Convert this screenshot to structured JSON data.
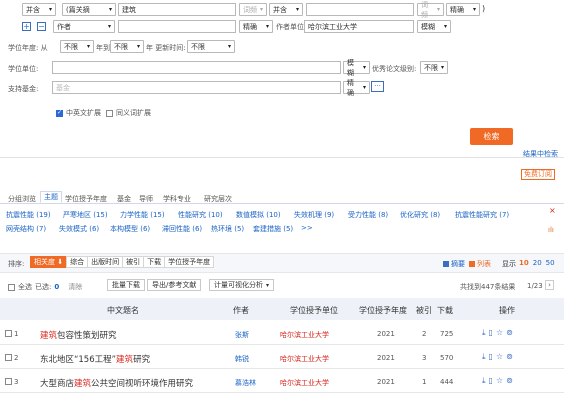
{
  "search": {
    "row1": {
      "logic": "并含",
      "field": "(篇关摘",
      "value": "建筑",
      "fuzzy": "词频",
      "logic2": "并含",
      "precision": "精确"
    },
    "row2": {
      "plus": "⊞",
      "minus": "⊟",
      "field": "作者",
      "value": "",
      "precision": "精确",
      "unit_label": "作者单位:",
      "unit_value": "哈尔滨工业大学",
      "unit_precision": "模糊"
    },
    "row3": {
      "label_year": "学位年度:",
      "from": "从",
      "from_val": "不限",
      "to": "年到",
      "to_val": "不限",
      "year_suffix": "年",
      "update_label": "更新时间:",
      "update_val": "不限"
    },
    "row4": {
      "label": "学位单位:",
      "precision": "模糊",
      "grade_label": "优秀论文级别:",
      "grade_val": "不限"
    },
    "row5": {
      "label": "支持基金:",
      "placeholder": "基金",
      "precision": "精确",
      "more": "···"
    },
    "options": {
      "bilingual": "中英文扩展",
      "synonym": "同义词扩展"
    },
    "submit": "检索",
    "in_result": "结果中检索",
    "subscribe": "免费订阅"
  },
  "group_tabs": {
    "label": "分组浏览",
    "items": [
      "主题",
      "学位授予年度",
      "基金",
      "导师",
      "学科专业",
      "研究层次"
    ]
  },
  "topic_tags": {
    "row1": [
      "抗震性能 (19)",
      "严寒地区 (15)",
      "力学性能 (15)",
      "性能研究 (10)",
      "数值模拟 (10)",
      "失效机理 (9)",
      "受力性能 (8)",
      "优化研究 (8)",
      "抗震性能研究 (7)"
    ],
    "row2": [
      "网壳结构 (7)",
      "失效模式 (6)",
      "本构模型 (6)",
      "滞回性能 (6)",
      "热环境 (5)",
      "套建措施 (5)",
      ">>"
    ],
    "close": "×"
  },
  "sort": {
    "label": "排序:",
    "items": [
      "相关度",
      "综合",
      "出版时间",
      "被引",
      "下载",
      "学位授予年度"
    ],
    "view_summary": "摘要",
    "view_list": "列表",
    "display_label": "显示",
    "sizes": [
      "10",
      "20",
      "50"
    ]
  },
  "toolbar": {
    "select_all": "全选",
    "selected": "已选:",
    "selected_count": "0",
    "clear": "清除",
    "batch_download": "批量下载",
    "export": "导出/参考文献",
    "visual": "计量可视化分析",
    "total": "共找到447条结果",
    "page": "1/23"
  },
  "table": {
    "headers": [
      "中文题名",
      "作者",
      "学位授予单位",
      "学位授予年度",
      "被引",
      "下载",
      "操作"
    ],
    "rows": [
      {
        "no": "1",
        "title_pre": "",
        "title_hl": "建筑",
        "title_post": "包容性策划研究",
        "author": "张斯",
        "unit": "哈尔滨工业大学",
        "year": "2021",
        "cited": "2",
        "download": "725"
      },
      {
        "no": "2",
        "title_pre": "东北地区“156工程”",
        "title_hl": "建筑",
        "title_post": "研究",
        "author": "韩锐",
        "unit": "哈尔滨工业大学",
        "year": "2021",
        "cited": "3",
        "download": "570"
      },
      {
        "no": "3",
        "title_pre": "大型商店",
        "title_hl": "建筑",
        "title_post": "公共空间视听环境作用研究",
        "author": "慕浩林",
        "unit": "哈尔滨工业大学",
        "year": "2021",
        "cited": "1",
        "download": "444"
      }
    ]
  },
  "colors": {
    "accent": "#f16a25",
    "link": "#1a63c6",
    "highlight": "#d9261c"
  }
}
